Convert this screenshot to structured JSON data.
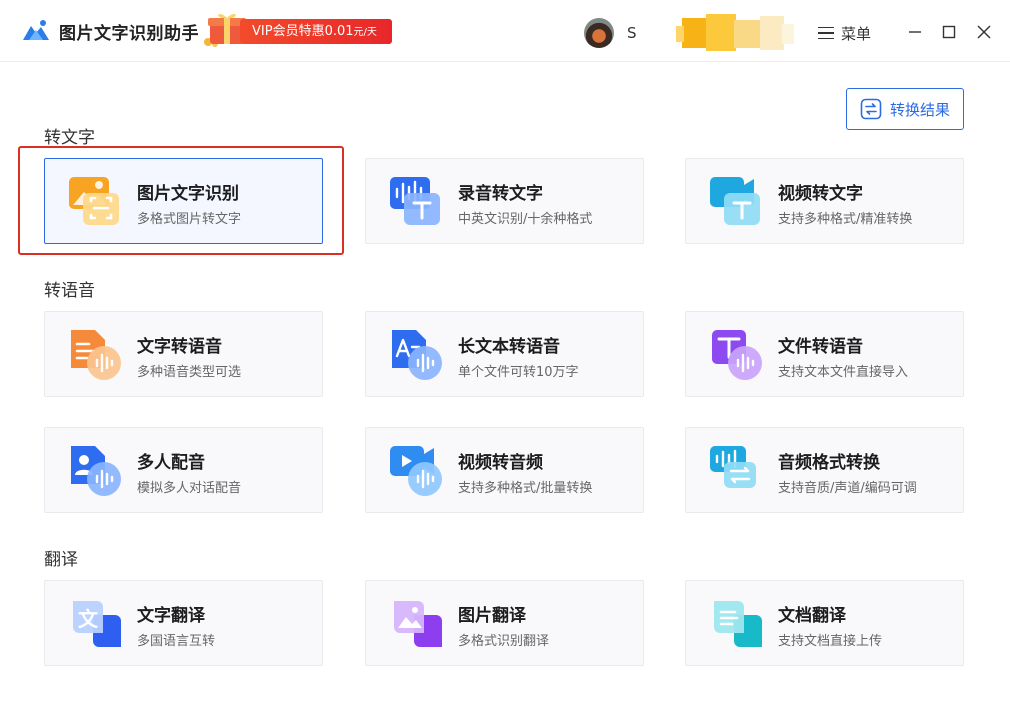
{
  "app": {
    "title": "图片文字识别助手"
  },
  "vip": {
    "label": "VIP会员特惠0.01",
    "unit": "元/天"
  },
  "user": {
    "name": "S"
  },
  "menu": {
    "label": "菜单"
  },
  "toolbar": {
    "result_label": "转换结果"
  },
  "sections": [
    {
      "title": "转文字"
    },
    {
      "title": "转语音"
    },
    {
      "title": "翻译"
    }
  ],
  "cards": [
    {
      "title": "图片文字识别",
      "desc": "多格式图片转文字",
      "icon": "image-ocr-icon"
    },
    {
      "title": "录音转文字",
      "desc": "中英文识别/十余种格式",
      "icon": "audio-to-text-icon"
    },
    {
      "title": "视频转文字",
      "desc": "支持多种格式/精准转换",
      "icon": "video-to-text-icon"
    },
    {
      "title": "文字转语音",
      "desc": "多种语音类型可选",
      "icon": "text-to-speech-icon"
    },
    {
      "title": "长文本转语音",
      "desc": "单个文件可转10万字",
      "icon": "long-text-to-speech-icon"
    },
    {
      "title": "文件转语音",
      "desc": "支持文本文件直接导入",
      "icon": "file-to-speech-icon"
    },
    {
      "title": "多人配音",
      "desc": "模拟多人对话配音",
      "icon": "multi-voice-dubbing-icon"
    },
    {
      "title": "视频转音频",
      "desc": "支持多种格式/批量转换",
      "icon": "video-to-audio-icon"
    },
    {
      "title": "音频格式转换",
      "desc": "支持音质/声道/编码可调",
      "icon": "audio-format-convert-icon"
    },
    {
      "title": "文字翻译",
      "desc": "多国语言互转",
      "icon": "text-translate-icon"
    },
    {
      "title": "图片翻译",
      "desc": "多格式识别翻译",
      "icon": "image-translate-icon"
    },
    {
      "title": "文档翻译",
      "desc": "支持文档直接上传",
      "icon": "document-translate-icon"
    }
  ],
  "colors": {
    "accent": "#2b6be6",
    "vip_red": "#e8262a",
    "highlight_frame": "#d93024",
    "card_bg": "#f9f9fb"
  }
}
